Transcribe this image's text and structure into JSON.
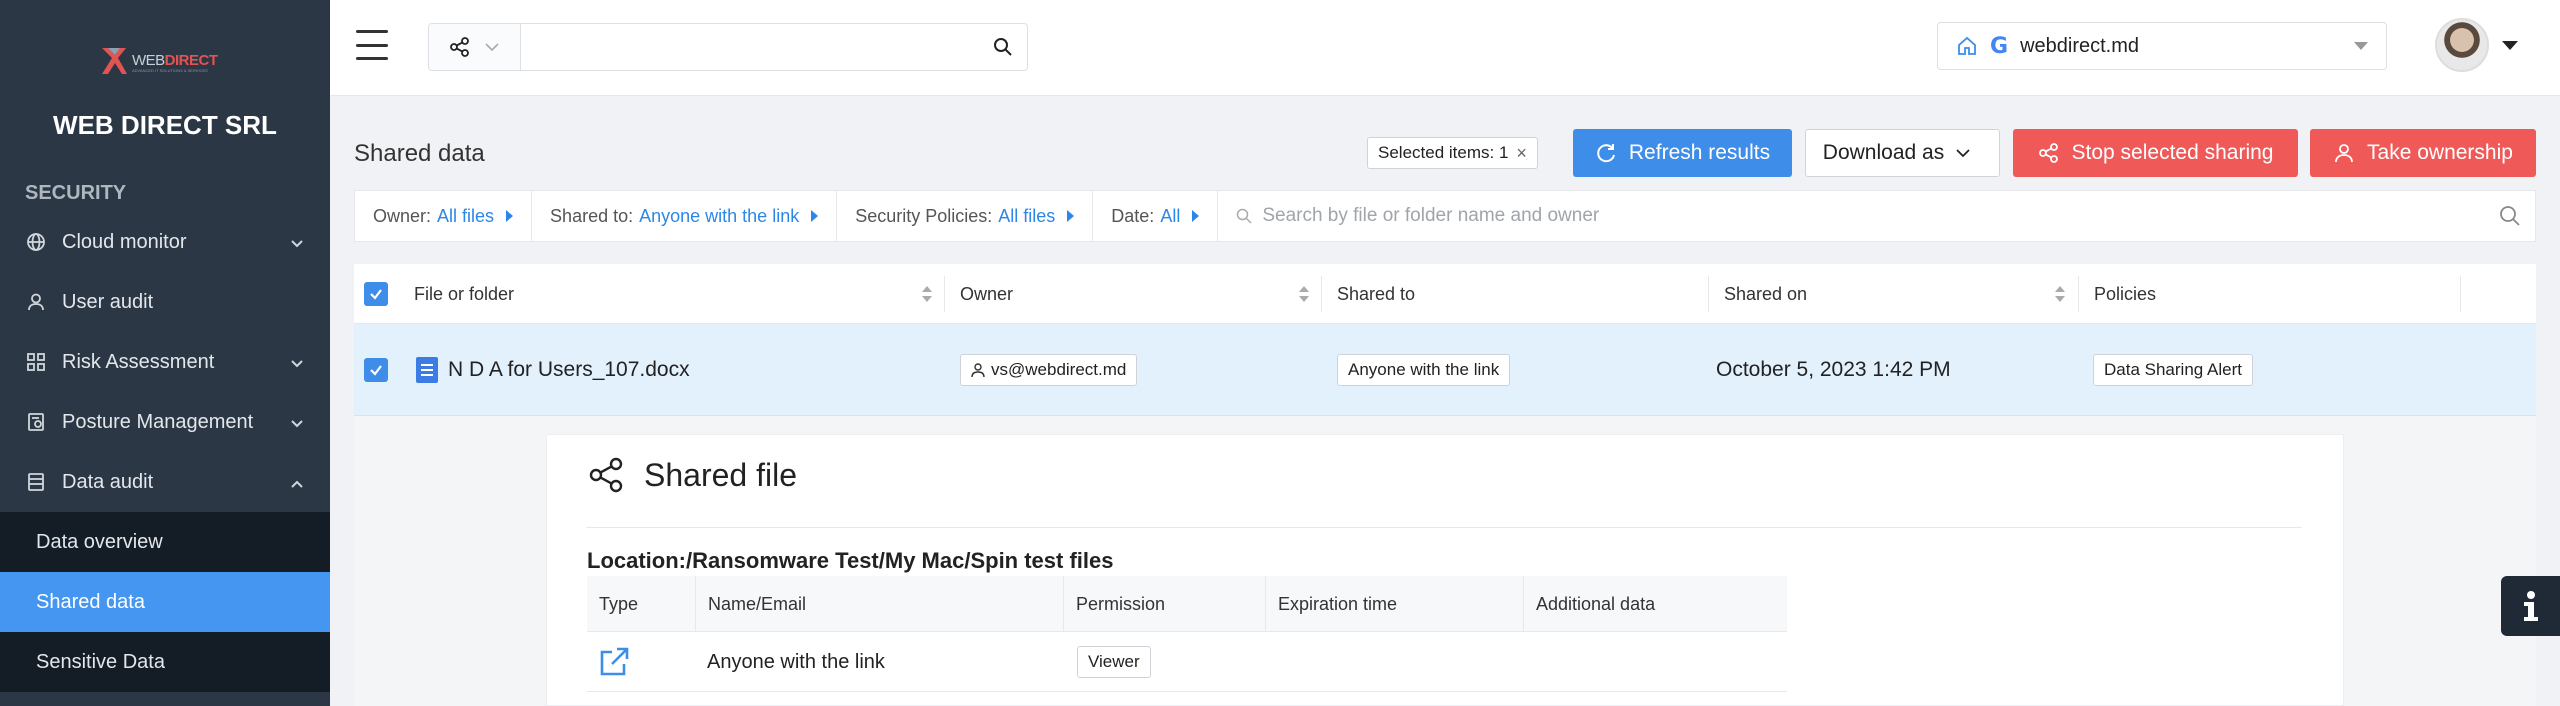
{
  "sidebar": {
    "logo_text_a": "WEB",
    "logo_text_b": "DIRECT",
    "logo_sub": "ADVANCED IT SOLUTIONS & SERVICES",
    "company": "WEB DIRECT SRL",
    "section": "SECURITY",
    "items": [
      {
        "label": "Cloud monitor",
        "icon": "globe-icon",
        "expandable": true
      },
      {
        "label": "User audit",
        "icon": "user-icon",
        "expandable": false
      },
      {
        "label": "Risk Assessment",
        "icon": "grid-icon",
        "expandable": true
      },
      {
        "label": "Posture Management",
        "icon": "clipboard-icon",
        "expandable": true
      },
      {
        "label": "Data audit",
        "icon": "database-icon",
        "expandable": true,
        "expanded": true
      }
    ],
    "subitems": [
      {
        "label": "Data overview"
      },
      {
        "label": "Shared data",
        "active": true
      },
      {
        "label": "Sensitive Data"
      }
    ]
  },
  "topbar": {
    "search_value": "",
    "search_placeholder": "",
    "domain": "webdirect.md"
  },
  "page": {
    "title": "Shared data",
    "selected_items": "Selected items: 1",
    "buttons": {
      "refresh": "Refresh results",
      "download": "Download as",
      "stop": "Stop selected sharing",
      "ownership": "Take ownership"
    }
  },
  "filters": {
    "owner_label": "Owner:",
    "owner_value": "All files",
    "shared_to_label": "Shared to:",
    "shared_to_value": "Anyone with the link",
    "policies_label": "Security Policies:",
    "policies_value": "All files",
    "date_label": "Date:",
    "date_value": "All",
    "search_placeholder": "Search by file or folder name and owner"
  },
  "table": {
    "headers": {
      "file": "File or folder",
      "owner": "Owner",
      "shared_to": "Shared to",
      "shared_on": "Shared on",
      "policies": "Policies"
    },
    "row": {
      "file": "N D A for Users_107.docx",
      "owner": "vs@webdirect.md",
      "shared_to": "Anyone with the link",
      "shared_on": "October 5, 2023 1:42 PM",
      "policy": "Data Sharing Alert"
    }
  },
  "detail": {
    "title": "Shared file",
    "location": "Location:/Ransomware Test/My Mac/Spin test files",
    "headers": {
      "type": "Type",
      "name": "Name/Email",
      "permission": "Permission",
      "expiration": "Expiration time",
      "additional": "Additional data"
    },
    "row": {
      "name": "Anyone with the link",
      "permission": "Viewer"
    }
  },
  "colors": {
    "sidebar_bg": "#2b3745",
    "active_item": "#4596f0",
    "primary": "#3e8de8",
    "danger": "#ef5a58",
    "row_highlight": "#e3f1fd"
  }
}
